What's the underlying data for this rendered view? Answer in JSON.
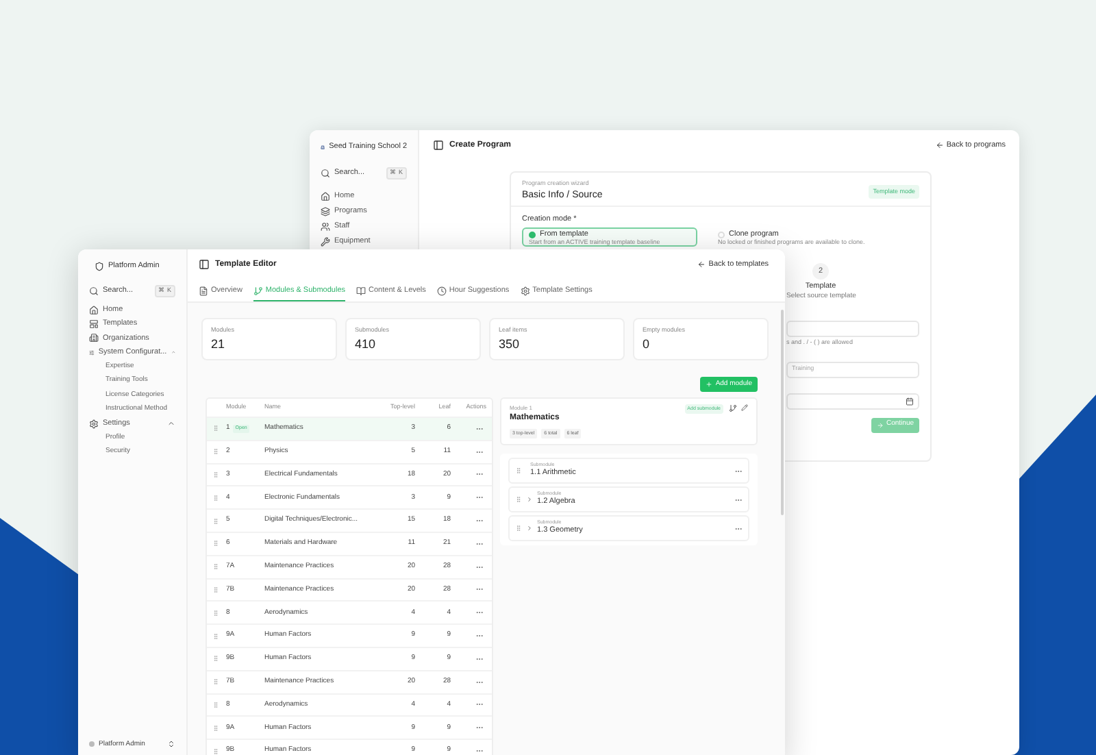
{
  "back_window": {
    "brand": "Seed Training School 2",
    "search": {
      "placeholder": "Search...",
      "shortcut": "⌘ K"
    },
    "nav": [
      {
        "label": "Home",
        "kind": "home"
      },
      {
        "label": "Programs",
        "kind": "programs"
      },
      {
        "label": "Staff",
        "kind": "staff"
      },
      {
        "label": "Equipment",
        "kind": "equipment"
      }
    ],
    "title": "Create Program",
    "back_link": "Back to programs",
    "wizard": {
      "eyebrow": "Program creation wizard",
      "title": "Basic Info / Source",
      "badge": "Template mode",
      "creation_mode_label": "Creation mode *",
      "options": [
        {
          "title": "From template",
          "description": "Start from an ACTIVE training template baseline",
          "selected": true
        },
        {
          "title": "Clone program",
          "description": "No locked or finished programs are available to clone.",
          "selected": false
        }
      ],
      "step": {
        "number": "2",
        "title": "Template",
        "subtitle": "Select source template"
      },
      "helper": "s and . / - ( ) are allowed",
      "name_field": {
        "placeholder": "Training"
      },
      "continue": "Continue"
    }
  },
  "front_window": {
    "brand": "Platform Admin",
    "search": {
      "placeholder": "Search...",
      "shortcut": "⌘ K"
    },
    "nav": [
      {
        "label": "Home",
        "kind": "home"
      },
      {
        "label": "Templates",
        "kind": "templates"
      },
      {
        "label": "Organizations",
        "kind": "organizations"
      },
      {
        "label": "System Configurat...",
        "kind": "config",
        "expanded": true,
        "children": [
          {
            "label": "Expertise"
          },
          {
            "label": "Training Tools"
          },
          {
            "label": "License Categories"
          },
          {
            "label": "Instructional Method"
          }
        ]
      },
      {
        "label": "Settings",
        "kind": "settings",
        "expanded": true,
        "children": [
          {
            "label": "Profile"
          },
          {
            "label": "Security"
          }
        ]
      }
    ],
    "account": "Platform Admin",
    "title": "Template Editor",
    "back_link": "Back to templates",
    "tabs": [
      {
        "label": "Overview",
        "kind": "overview",
        "selected": false
      },
      {
        "label": "Modules & Submodules",
        "kind": "modules",
        "selected": true
      },
      {
        "label": "Content & Levels",
        "kind": "content",
        "selected": false
      },
      {
        "label": "Hour Suggestions",
        "kind": "hours",
        "selected": false
      },
      {
        "label": "Template Settings",
        "kind": "settings",
        "selected": false
      }
    ],
    "stats": [
      {
        "label": "Modules",
        "value": "21"
      },
      {
        "label": "Submodules",
        "value": "410"
      },
      {
        "label": "Leaf items",
        "value": "350"
      },
      {
        "label": "Empty modules",
        "value": "0"
      }
    ],
    "add_module": "Add module",
    "table": {
      "columns": [
        "Module",
        "Name",
        "Top-level",
        "Leaf",
        "Actions"
      ],
      "rows": [
        {
          "module": "1",
          "badge": "Open",
          "name": "Mathematics",
          "top_level": "3",
          "leaf": "6",
          "selected": true
        },
        {
          "module": "2",
          "name": "Physics",
          "top_level": "5",
          "leaf": "11",
          "selected": false
        },
        {
          "module": "3",
          "name": "Electrical Fundamentals",
          "top_level": "18",
          "leaf": "20",
          "selected": false
        },
        {
          "module": "4",
          "name": "Electronic Fundamentals",
          "top_level": "3",
          "leaf": "9",
          "selected": false
        },
        {
          "module": "5",
          "name": "Digital Techniques/Electronic...",
          "top_level": "15",
          "leaf": "18",
          "selected": false
        },
        {
          "module": "6",
          "name": "Materials and Hardware",
          "top_level": "11",
          "leaf": "21",
          "selected": false
        },
        {
          "module": "7A",
          "name": "Maintenance Practices",
          "top_level": "20",
          "leaf": "28",
          "selected": false
        },
        {
          "module": "7B",
          "name": "Maintenance Practices",
          "top_level": "20",
          "leaf": "28",
          "selected": false
        },
        {
          "module": "8",
          "name": "Aerodynamics",
          "top_level": "4",
          "leaf": "4",
          "selected": false
        },
        {
          "module": "9A",
          "name": "Human Factors",
          "top_level": "9",
          "leaf": "9",
          "selected": false
        },
        {
          "module": "9B",
          "name": "Human Factors",
          "top_level": "9",
          "leaf": "9",
          "selected": false
        },
        {
          "module": "7B",
          "name": "Maintenance Practices",
          "top_level": "20",
          "leaf": "28",
          "selected": false
        },
        {
          "module": "8",
          "name": "Aerodynamics",
          "top_level": "4",
          "leaf": "4",
          "selected": false
        },
        {
          "module": "9A",
          "name": "Human Factors",
          "top_level": "9",
          "leaf": "9",
          "selected": false
        },
        {
          "module": "9B",
          "name": "Human Factors",
          "top_level": "9",
          "leaf": "9",
          "selected": false
        }
      ]
    },
    "detail": {
      "eyebrow": "Module 1",
      "title": "Mathematics",
      "chips": [
        "3 top-level",
        "6 total",
        "6 leaf"
      ],
      "add_submodule": "Add submodule",
      "submodules": [
        {
          "eyebrow": "Submodule",
          "title": "1.1 Arithmetic",
          "expandable": false
        },
        {
          "eyebrow": "Submodule",
          "title": "1.2 Algebra",
          "expandable": true
        },
        {
          "eyebrow": "Submodule",
          "title": "1.3 Geometry",
          "expandable": true
        }
      ]
    }
  }
}
